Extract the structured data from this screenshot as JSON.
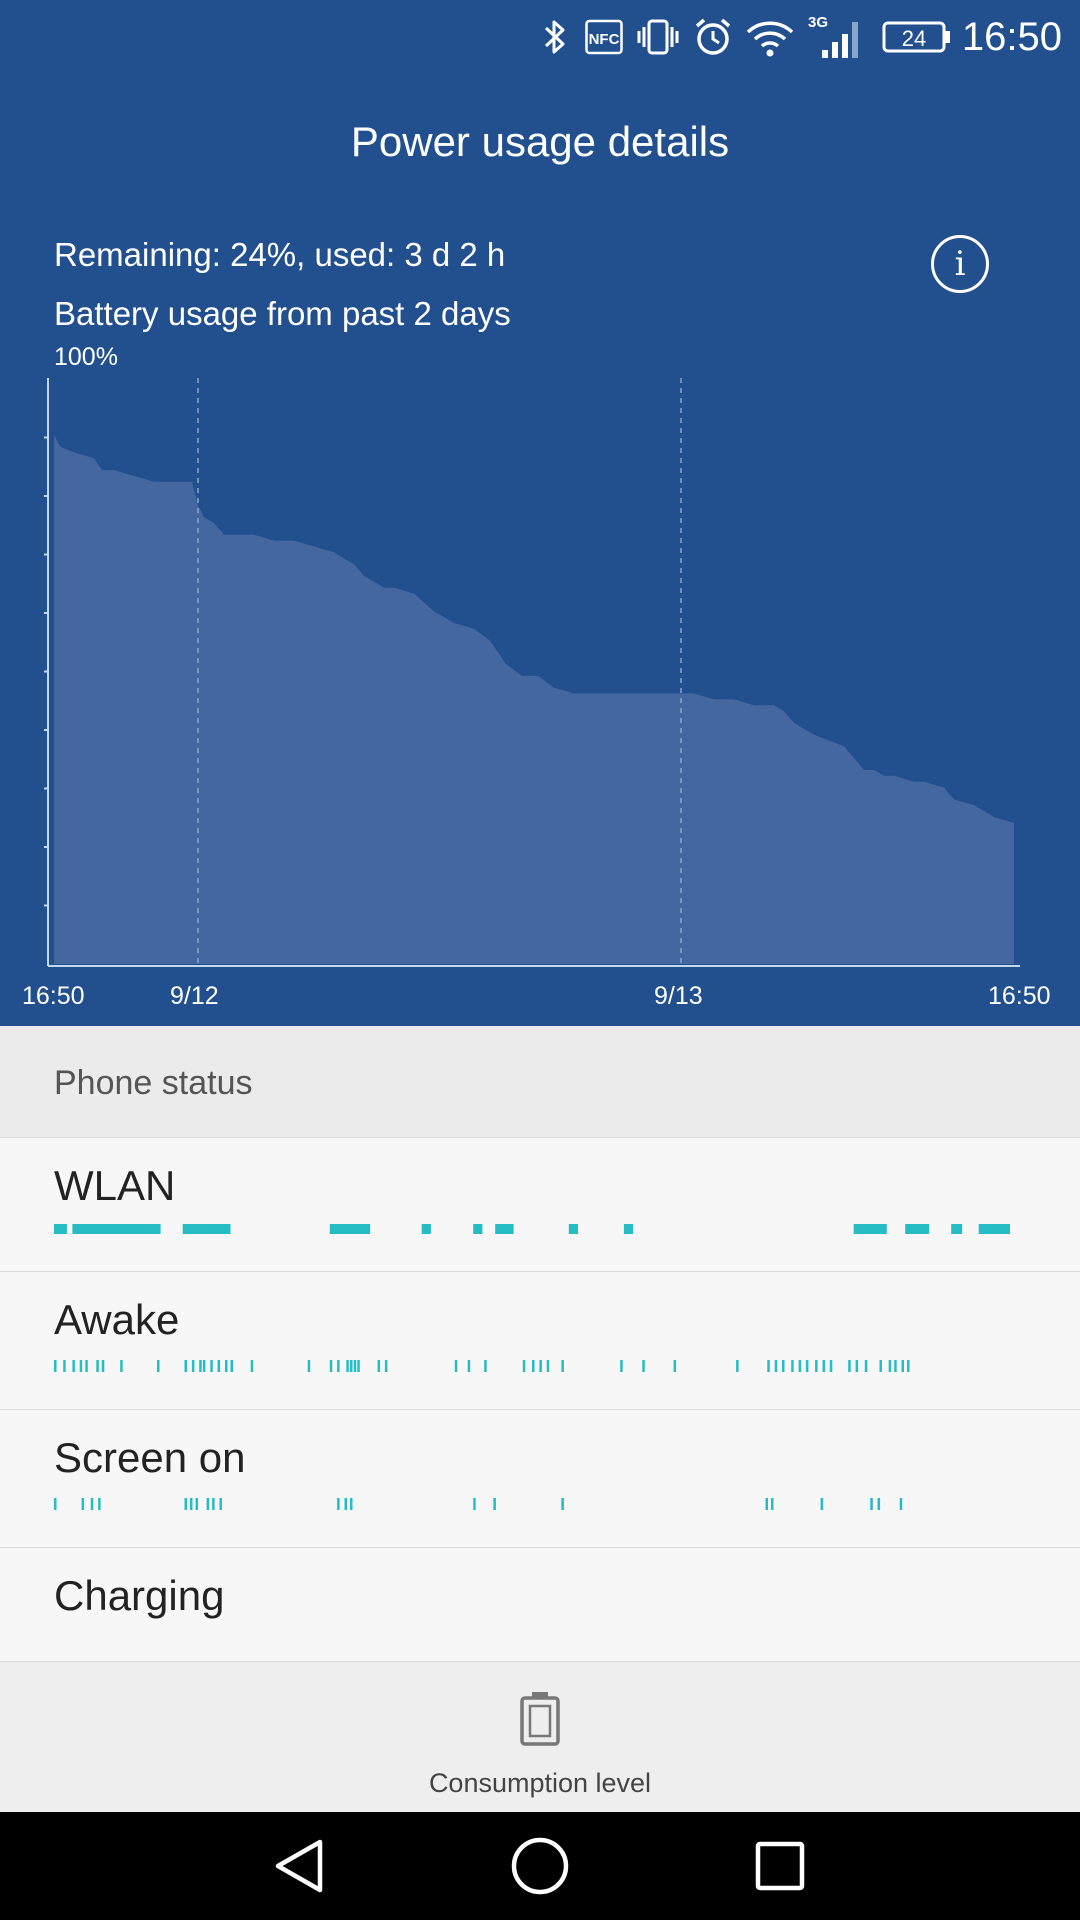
{
  "status_bar": {
    "time": "16:50",
    "battery_level": "24",
    "network_type": "3G",
    "nfc_label": "NFC",
    "icons": [
      "bluetooth-icon",
      "nfc-icon",
      "vibrate-icon",
      "alarm-icon",
      "wifi-icon",
      "signal-icon",
      "battery-icon"
    ]
  },
  "header": {
    "title": "Power usage details"
  },
  "summary": {
    "remaining": "Remaining: 24%, used: 3 d 2 h",
    "period": "Battery usage from past 2 days",
    "info_icon": "i"
  },
  "chart_data": {
    "type": "area",
    "title": "",
    "ylabel_top": "100%",
    "x_labels": [
      "16:50",
      "9/12",
      "9/13",
      "16:50"
    ],
    "ylim": [
      0,
      100
    ],
    "x_unit": "hours from start",
    "x_range": [
      0,
      48
    ],
    "x": [
      0,
      0.3,
      1,
      2,
      2.4,
      3,
      4,
      5,
      6,
      6.9,
      7.2,
      7.5,
      8,
      8.5,
      9,
      10,
      11,
      12,
      13,
      14,
      15,
      15.5,
      16,
      16.5,
      17,
      18,
      19,
      20,
      21,
      21.8,
      22.2,
      22.6,
      23,
      23.4,
      23.8,
      24.2,
      25,
      26,
      27,
      28,
      29,
      30,
      31,
      32,
      33,
      34,
      35,
      36,
      36.5,
      37,
      38,
      39.5,
      40.5,
      41,
      41.5,
      42,
      43,
      43.5,
      44.5,
      45,
      46,
      47,
      48
    ],
    "y": [
      90,
      88,
      87,
      86,
      84,
      84,
      83,
      82,
      82,
      82,
      78,
      76,
      75,
      73,
      73,
      73,
      72,
      72,
      71,
      70,
      68,
      66,
      65,
      64,
      64,
      63,
      60,
      58,
      57,
      55,
      53,
      51,
      50,
      49,
      49,
      49,
      47,
      46,
      46,
      46,
      46,
      46,
      46,
      46,
      45,
      45,
      44,
      44,
      43,
      41,
      39,
      37,
      33,
      33,
      32,
      32,
      31,
      31,
      30,
      28,
      27,
      25,
      24
    ],
    "grid": "vertical dashed lines at 9/12 and 9/13",
    "fill_color": "#4467a0",
    "axis_color": "#c8d6ea"
  },
  "phone_status": {
    "header": "Phone status",
    "accent_color": "#26bcc4",
    "span_unit": "hours from start (0-48)",
    "rows": [
      {
        "label": "WLAN",
        "spans": [
          [
            0,
            0.7
          ],
          [
            1,
            5.8
          ],
          [
            7,
            9.6
          ],
          [
            15,
            17.2
          ],
          [
            20,
            20.5
          ],
          [
            22.8,
            23.3
          ],
          [
            24,
            25
          ],
          [
            28,
            28.5
          ],
          [
            31,
            31.5
          ],
          [
            43.5,
            45.3
          ],
          [
            46.3,
            47.6
          ],
          [
            48.8,
            49.4
          ],
          [
            50.3,
            52
          ]
        ]
      },
      {
        "label": "Awake",
        "ticks": [
          0,
          0.5,
          1,
          1.4,
          1.7,
          2.3,
          2.6,
          3.6,
          5.6,
          7.1,
          7.5,
          7.9,
          8.1,
          8.5,
          8.9,
          9.3,
          9.6,
          10.7,
          13.8,
          15,
          15.4,
          15.9,
          16.1,
          16.3,
          16.5,
          17.6,
          18,
          21.8,
          22.5,
          23.4,
          25.5,
          26,
          26.4,
          26.8,
          27.6,
          30.8,
          32,
          33.7,
          37.1,
          38.8,
          39.2,
          39.6,
          40.1,
          40.5,
          40.9,
          41.4,
          41.8,
          42.2,
          43.2,
          43.6,
          44.1,
          44.9,
          45.4,
          45.7,
          46.1,
          46.4
        ]
      },
      {
        "label": "Screen on",
        "ticks": [
          0,
          1.5,
          2,
          2.4,
          7.1,
          7.4,
          7.7,
          8.3,
          8.6,
          9,
          15.4,
          15.8,
          16.1,
          22.8,
          23.9,
          27.6,
          38.7,
          39,
          41.7,
          44.4,
          44.8,
          46
        ]
      },
      {
        "label": "Charging",
        "ticks": []
      }
    ]
  },
  "footer": {
    "label": "Consumption level",
    "icon": "battery-level-icon"
  },
  "nav": {
    "back": "back-icon",
    "home": "home-icon",
    "recents": "recents-icon"
  }
}
